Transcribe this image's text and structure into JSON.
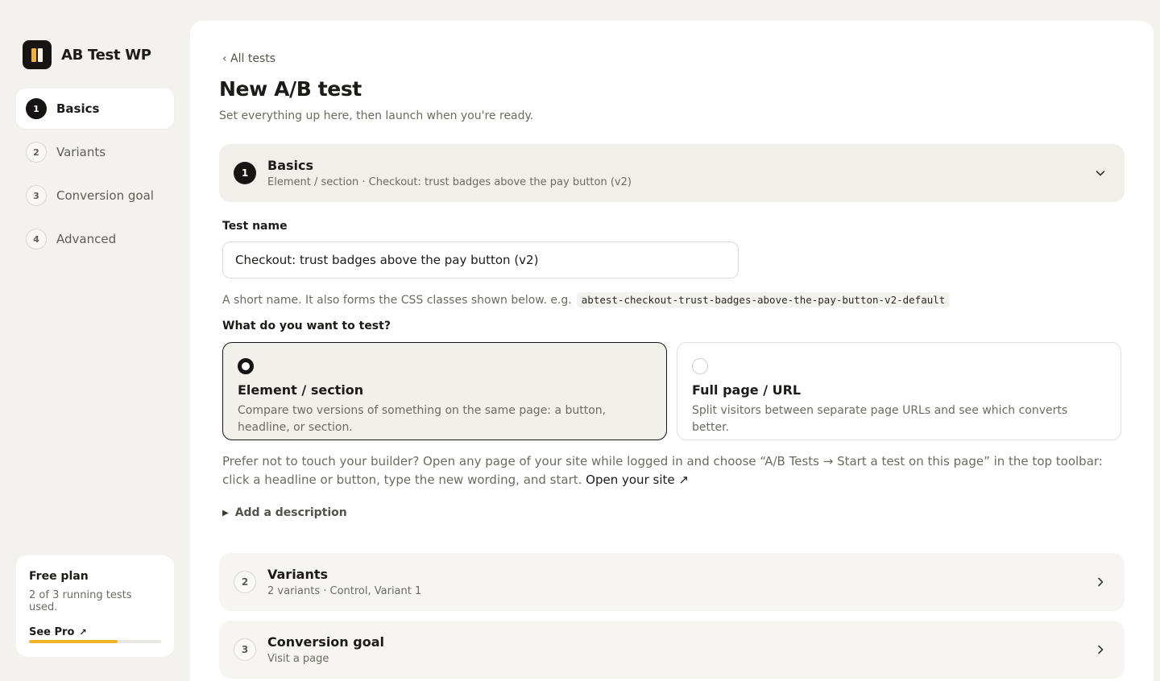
{
  "brand": {
    "name": "AB Test WP"
  },
  "sidebar": {
    "items": [
      {
        "num": "1",
        "label": "Basics"
      },
      {
        "num": "2",
        "label": "Variants"
      },
      {
        "num": "3",
        "label": "Conversion goal"
      },
      {
        "num": "4",
        "label": "Advanced"
      }
    ],
    "active_index": 0
  },
  "plan": {
    "title": "Free plan",
    "usage": "2 of 3 running tests used.",
    "link": "See Pro",
    "link_icon": "external-arrow-icon",
    "used_fraction": 0.67,
    "accent_color": "#f2b325"
  },
  "header": {
    "back": "‹ All tests",
    "title": "New A/B test",
    "subtitle": "Set everything up here, then launch when you're ready."
  },
  "sections": [
    {
      "num": "1",
      "title": "Basics",
      "summary": "Element / section · Checkout: trust badges above the pay button (v2)",
      "expanded": true
    },
    {
      "num": "2",
      "title": "Variants",
      "summary": "2 variants · Control, Variant 1",
      "expanded": false
    },
    {
      "num": "3",
      "title": "Conversion goal",
      "summary": "Visit a page",
      "expanded": false
    }
  ],
  "basics": {
    "test_name_label": "Test name",
    "test_name_value": "Checkout: trust badges above the pay button (v2)",
    "helper_text": "A short name. It also forms the CSS classes shown below. e.g.",
    "css_class_example": "abtest-checkout-trust-badges-above-the-pay-button-v2-default",
    "question": "What do you want to test?",
    "options": [
      {
        "title": "Element / section",
        "desc": "Compare two versions of something on the same page: a button, headline, or section.",
        "selected": true
      },
      {
        "title": "Full page / URL",
        "desc": "Split visitors between separate page URLs and see which converts better.",
        "selected": false
      }
    ],
    "note_text": "Prefer not to touch your builder? Open any page of your site while logged in and choose “A/B Tests → Start a test on this page” in the top toolbar: click a headline or button, type the new wording, and start.",
    "note_link": "Open your site ↗",
    "add_description": "Add a description"
  }
}
